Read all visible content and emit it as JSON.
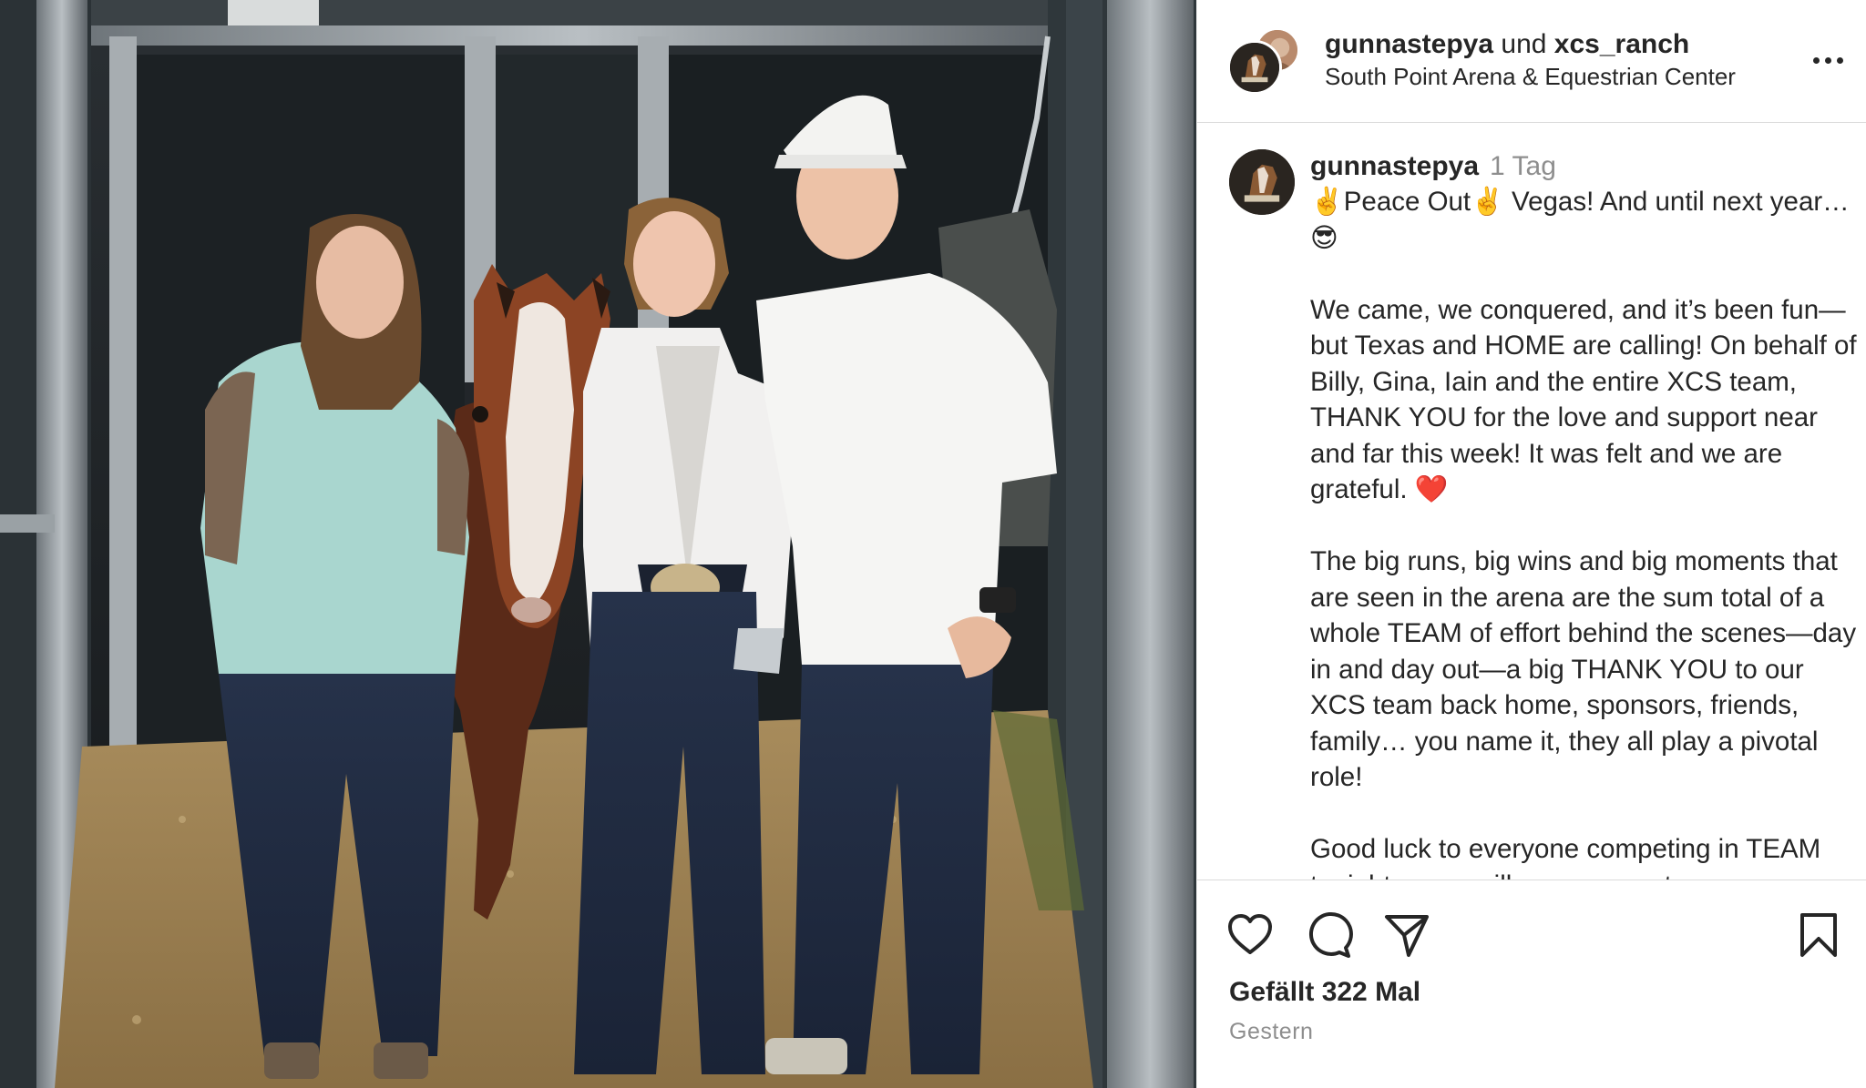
{
  "post": {
    "header": {
      "username": "gunnastepya",
      "joiner": "und",
      "collaborator": "xcs_ranch",
      "location": "South Point Arena & Equestrian Center"
    },
    "caption": {
      "username": "gunnastepya",
      "time": "1 Tag",
      "text": "✌️Peace Out✌️ Vegas! And until next year… 😎\n\nWe came, we conquered, and it’s been fun—but Texas and HOME are calling! On behalf of Billy, Gina, Iain and the entire XCS team, THANK YOU for the love and support near and far this week! It was felt and we are grateful. ❤️\n\nThe big runs, big wins and big moments that are seen in the arena are the sum total of a whole TEAM of effort behind the scenes—day in and day out—a big THANK YOU to our XCS team back home, sponsors, friends, family… you name it, they all play a pivotal role!\n\nGood luck to everyone competing in TEAM tonight — we will see you next"
    },
    "likes_text": "Gefällt 322 Mal",
    "date_text": "Gestern"
  },
  "icons": {
    "more": "more-options-icon",
    "like": "heart-icon",
    "comment": "comment-bubble-icon",
    "share": "paper-plane-icon",
    "save": "bookmark-icon"
  },
  "colors": {
    "text": "#262626",
    "secondary_text": "#8e8e8e",
    "divider": "#dbdbdb"
  }
}
